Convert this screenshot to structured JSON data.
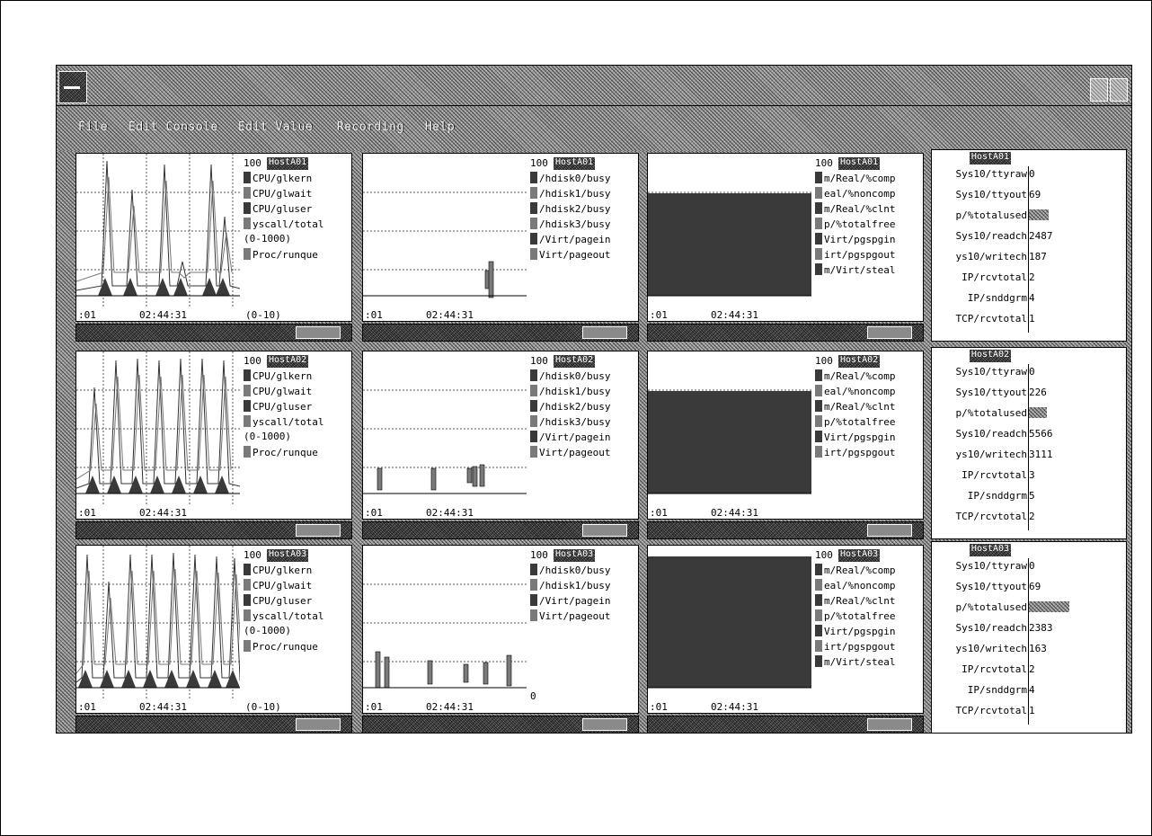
{
  "menu": [
    {
      "label": "File"
    },
    {
      "label": "Edit Console"
    },
    {
      "label": "Edit Value"
    },
    {
      "label": "Recording"
    },
    {
      "label": "Help"
    }
  ],
  "colors": {
    "background": "#ffffff",
    "chrome": "#9a9a9a",
    "dark_fill": "#3a3a3a",
    "text": "#000000"
  },
  "rows": [
    {
      "cpu": {
        "tag": "HostA01",
        "scale": "100",
        "lines": [
          "CPU/glkern",
          "CPU/glwait",
          "CPU/gluser",
          "yscall/total",
          "(0-1000)",
          "Proc/runque"
        ],
        "swatch": [
          true,
          true,
          true,
          true,
          false,
          true
        ],
        "extra": "(0-10)",
        "time_left": ":01",
        "time_mid": "02:44:31"
      },
      "disk": {
        "tag": "HostA01",
        "scale": "100",
        "lines": [
          "/hdisk0/busy",
          "/hdisk1/busy",
          "/hdisk2/busy",
          "/hdisk3/busy",
          "/Virt/pagein",
          "Virt/pageout"
        ],
        "time_left": ":01",
        "time_mid": "02:44:31"
      },
      "mem": {
        "tag": "HostA01",
        "scale": "100",
        "lines": [
          "m/Real/%comp",
          "eal/%noncomp",
          "m/Real/%clnt",
          "p/%totalfree",
          "Virt/pgspgin",
          "irt/pgspgout",
          "m/Virt/steal"
        ],
        "time_left": ":01",
        "time_mid": "02:44:31"
      },
      "table": {
        "tag": "HostA01",
        "rows": [
          {
            "key": "Sys10/ttyraw",
            "value": "0"
          },
          {
            "key": "Sys10/ttyout",
            "value": "69"
          },
          {
            "key": "p/%totalused",
            "value": ""
          },
          {
            "key": "Sys10/readch",
            "value": "2487"
          },
          {
            "key": "ys10/writech",
            "value": "187"
          },
          {
            "key": "IP/rcvtotal",
            "value": "2"
          },
          {
            "key": "IP/snddgrm",
            "value": "4"
          },
          {
            "key": "TCP/rcvtotal",
            "value": "1"
          }
        ],
        "used_fraction": 0.22
      }
    },
    {
      "cpu": {
        "tag": "HostA02",
        "scale": "100",
        "lines": [
          "CPU/glkern",
          "CPU/glwait",
          "CPU/gluser",
          "yscall/total",
          "(0-1000)",
          "Proc/runque"
        ],
        "swatch": [
          true,
          true,
          true,
          true,
          false,
          true
        ],
        "extra": "",
        "time_left": ":01",
        "time_mid": "02:44:31"
      },
      "disk": {
        "tag": "HostA02",
        "scale": "100",
        "lines": [
          "/hdisk0/busy",
          "/hdisk1/busy",
          "/hdisk2/busy",
          "/hdisk3/busy",
          "/Virt/pagein",
          "Virt/pageout"
        ],
        "time_left": ":01",
        "time_mid": "02:44:31"
      },
      "mem": {
        "tag": "HostA02",
        "scale": "100",
        "lines": [
          "m/Real/%comp",
          "eal/%noncomp",
          "m/Real/%clnt",
          "p/%totalfree",
          "Virt/pgspgin",
          "irt/pgspgout"
        ],
        "time_left": ":01",
        "time_mid": "02:44:31"
      },
      "table": {
        "tag": "HostA02",
        "rows": [
          {
            "key": "Sys10/ttyraw",
            "value": "0"
          },
          {
            "key": "Sys10/ttyout",
            "value": "226"
          },
          {
            "key": "p/%totalused",
            "value": ""
          },
          {
            "key": "Sys10/readch",
            "value": "5566"
          },
          {
            "key": "ys10/writech",
            "value": "3111"
          },
          {
            "key": "IP/rcvtotal",
            "value": "3"
          },
          {
            "key": "IP/snddgrm",
            "value": "5"
          },
          {
            "key": "TCP/rcvtotal",
            "value": "2"
          }
        ],
        "used_fraction": 0.2
      }
    },
    {
      "cpu": {
        "tag": "HostA03",
        "scale": "100",
        "lines": [
          "CPU/glkern",
          "CPU/glwait",
          "CPU/gluser",
          "yscall/total",
          "(0-1000)",
          "Proc/runque"
        ],
        "swatch": [
          true,
          true,
          true,
          true,
          false,
          true
        ],
        "extra": "(0-10)",
        "time_left": ":01",
        "time_mid": "02:44:31"
      },
      "disk": {
        "tag": "HostA03",
        "scale": "100",
        "lines": [
          "/hdisk0/busy",
          "/hdisk1/busy",
          "/Virt/pagein",
          "Virt/pageout"
        ],
        "time_left": ":01",
        "time_mid": "02:44:31",
        "bottom": "0"
      },
      "mem": {
        "tag": "HostA03",
        "scale": "100",
        "lines": [
          "m/Real/%comp",
          "eal/%noncomp",
          "m/Real/%clnt",
          "p/%totalfree",
          "Virt/pgspgin",
          "irt/pgspgout",
          "m/Virt/steal"
        ],
        "time_left": ":01",
        "time_mid": "02:44:31"
      },
      "table": {
        "tag": "HostA03",
        "rows": [
          {
            "key": "Sys10/ttyraw",
            "value": "0"
          },
          {
            "key": "Sys10/ttyout",
            "value": "69"
          },
          {
            "key": "p/%totalused",
            "value": ""
          },
          {
            "key": "Sys10/readch",
            "value": "2383"
          },
          {
            "key": "ys10/writech",
            "value": "163"
          },
          {
            "key": "IP/rcvtotal",
            "value": "2"
          },
          {
            "key": "IP/snddgrm",
            "value": "4"
          },
          {
            "key": "TCP/rcvtotal",
            "value": "1"
          }
        ],
        "used_fraction": 0.45
      }
    }
  ]
}
